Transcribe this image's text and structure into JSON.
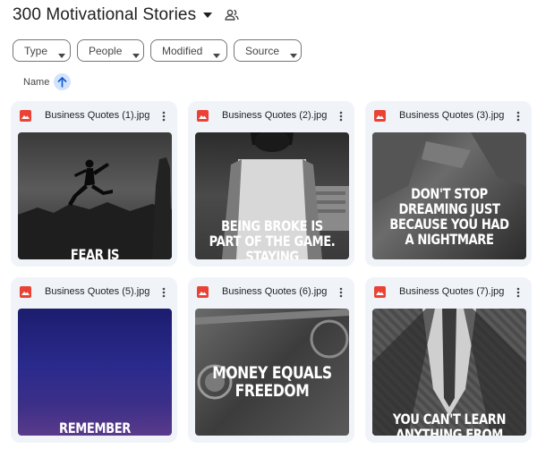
{
  "header": {
    "title": "300 Motivational Stories",
    "title_caret_icon": "caret-down-icon",
    "shared_icon": "shared-people-icon"
  },
  "filters": [
    {
      "label": "Type",
      "icon": "caret-down-icon"
    },
    {
      "label": "People",
      "icon": "caret-down-icon"
    },
    {
      "label": "Modified",
      "icon": "caret-down-icon"
    },
    {
      "label": "Source",
      "icon": "caret-down-icon"
    }
  ],
  "sort": {
    "label": "Name",
    "direction_icon": "arrow-up-icon",
    "accent_color": "#d3e3fd"
  },
  "files": [
    {
      "name": "Business Quotes (1).jpg",
      "thumb_text": "FEAR IS",
      "file_icon": "image-file-icon",
      "menu_icon": "more-vert-icon"
    },
    {
      "name": "Business Quotes (2).jpg",
      "thumb_text": "BEING BROKE IS PART OF THE GAME. STAYING",
      "file_icon": "image-file-icon",
      "menu_icon": "more-vert-icon"
    },
    {
      "name": "Business Quotes (3).jpg",
      "thumb_text": "DON'T STOP DREAMING JUST BECAUSE YOU HAD A NIGHTMARE",
      "file_icon": "image-file-icon",
      "menu_icon": "more-vert-icon"
    },
    {
      "name": "Business Quotes (5).jpg",
      "thumb_text": "REMEMBER",
      "file_icon": "image-file-icon",
      "menu_icon": "more-vert-icon"
    },
    {
      "name": "Business Quotes (6).jpg",
      "thumb_text": "MONEY EQUALS FREEDOM",
      "file_icon": "image-file-icon",
      "menu_icon": "more-vert-icon"
    },
    {
      "name": "Business Quotes (7).jpg",
      "thumb_text": "YOU CAN'T LEARN ANYTHING FROM",
      "file_icon": "image-file-icon",
      "menu_icon": "more-vert-icon"
    }
  ],
  "colors": {
    "card_bg": "#f0f4f9",
    "file_icon": "#ea4335",
    "chip_border": "#747775"
  }
}
